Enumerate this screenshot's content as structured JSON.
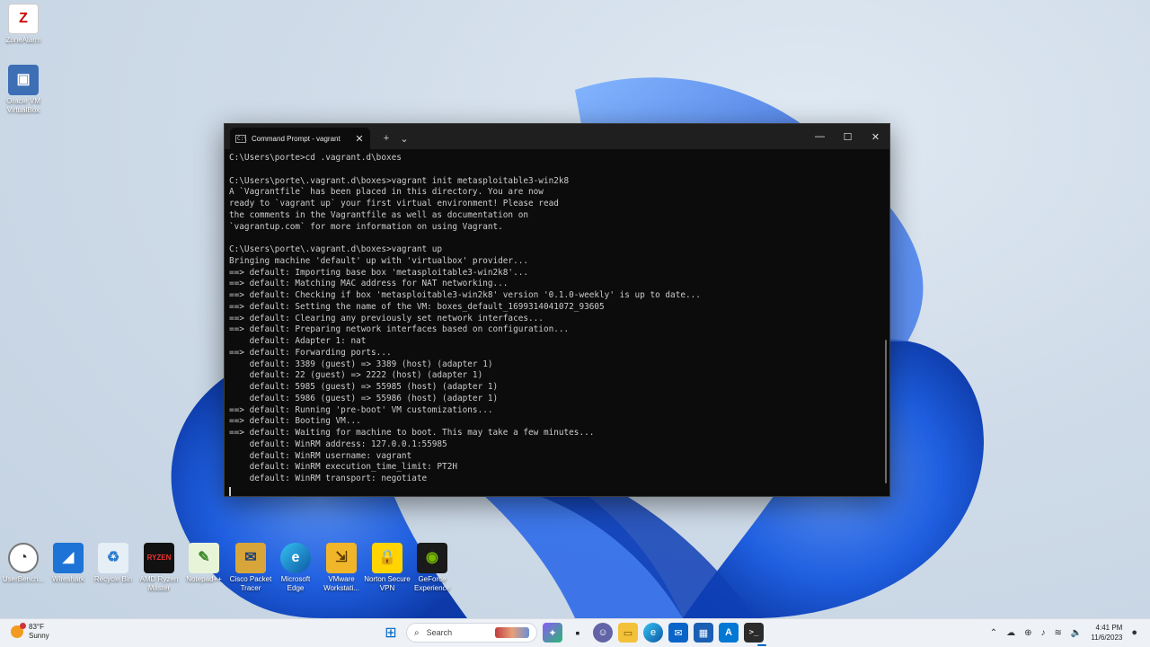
{
  "desktop_icons": [
    {
      "label": "ZoneAlarm",
      "icon": "zonealarm-icon"
    },
    {
      "label": "Oracle VM VirtualBox",
      "icon": "virtualbox-icon"
    },
    {
      "label": "UserBench...",
      "icon": "gauge-icon"
    },
    {
      "label": "Wireshark",
      "icon": "wireshark-icon"
    },
    {
      "label": "Recycle Bin",
      "icon": "recycle-bin-icon"
    },
    {
      "label": "AMD Ryzen Master",
      "icon": "ryzen-icon"
    },
    {
      "label": "Notepad++",
      "icon": "notepad-plus-icon"
    },
    {
      "label": "Cisco Packet Tracer",
      "icon": "packet-tracer-icon"
    },
    {
      "label": "Microsoft Edge",
      "icon": "edge-icon"
    },
    {
      "label": "VMware Workstati...",
      "icon": "vmware-icon"
    },
    {
      "label": "Norton Secure VPN",
      "icon": "norton-vpn-icon"
    },
    {
      "label": "GeForce Experience",
      "icon": "geforce-icon"
    }
  ],
  "terminal": {
    "tab_title": "Command Prompt - vagrant",
    "new_tab_symbol": "+",
    "dropdown_symbol": "⌄",
    "lines": [
      "C:\\Users\\porte>cd .vagrant.d\\boxes",
      "",
      "C:\\Users\\porte\\.vagrant.d\\boxes>vagrant init metasploitable3-win2k8",
      "A `Vagrantfile` has been placed in this directory. You are now",
      "ready to `vagrant up` your first virtual environment! Please read",
      "the comments in the Vagrantfile as well as documentation on",
      "`vagrantup.com` for more information on using Vagrant.",
      "",
      "C:\\Users\\porte\\.vagrant.d\\boxes>vagrant up",
      "Bringing machine 'default' up with 'virtualbox' provider...",
      "==> default: Importing base box 'metasploitable3-win2k8'...",
      "==> default: Matching MAC address for NAT networking...",
      "==> default: Checking if box 'metasploitable3-win2k8' version '0.1.0-weekly' is up to date...",
      "==> default: Setting the name of the VM: boxes_default_1699314041072_93605",
      "==> default: Clearing any previously set network interfaces...",
      "==> default: Preparing network interfaces based on configuration...",
      "    default: Adapter 1: nat",
      "==> default: Forwarding ports...",
      "    default: 3389 (guest) => 3389 (host) (adapter 1)",
      "    default: 22 (guest) => 2222 (host) (adapter 1)",
      "    default: 5985 (guest) => 55985 (host) (adapter 1)",
      "    default: 5986 (guest) => 55986 (host) (adapter 1)",
      "==> default: Running 'pre-boot' VM customizations...",
      "==> default: Booting VM...",
      "==> default: Waiting for machine to boot. This may take a few minutes...",
      "    default: WinRM address: 127.0.0.1:55985",
      "    default: WinRM username: vagrant",
      "    default: WinRM execution_time_limit: PT2H",
      "    default: WinRM transport: negotiate"
    ]
  },
  "taskbar": {
    "weather_temp": "83°F",
    "weather_desc": "Sunny",
    "search_placeholder": "Search",
    "time": "4:41 PM",
    "date": "11/6/2023"
  },
  "colors": {
    "terminal_bg": "#0c0c0c",
    "terminal_text": "#cccccc",
    "wallpaper_blue": "#1f5fe0",
    "taskbar_bg": "#eef1f6"
  }
}
